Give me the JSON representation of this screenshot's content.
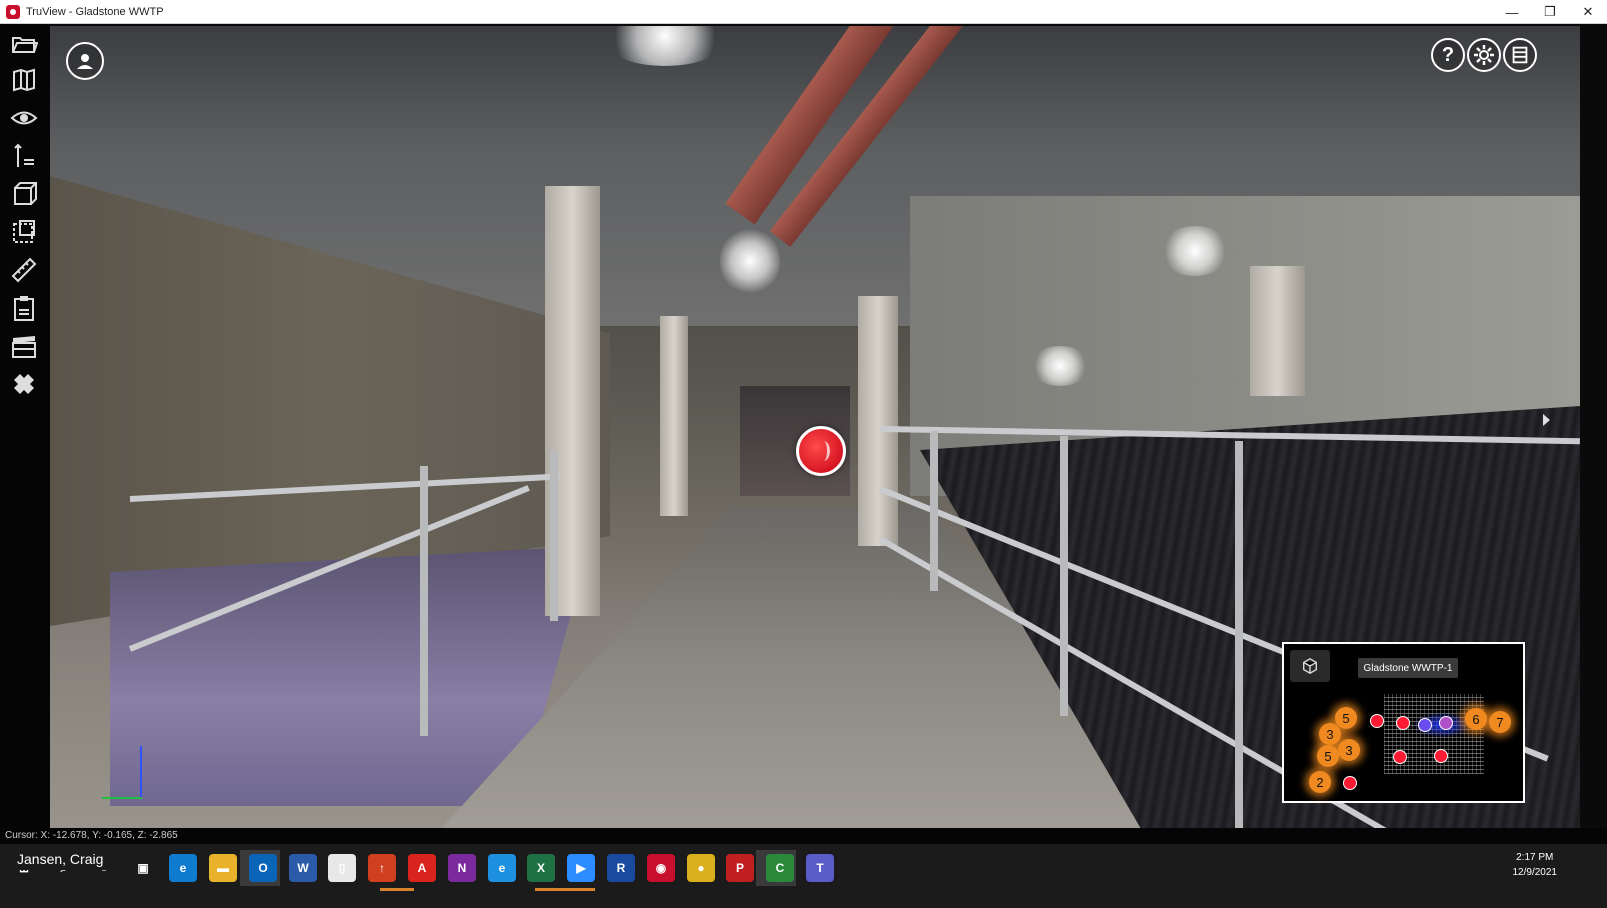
{
  "window": {
    "title": "TruView - Gladstone WWTP",
    "controls": {
      "minimize": "—",
      "maximize": "❐",
      "close": "✕"
    }
  },
  "sidebar": {
    "tools": [
      {
        "icon": "open-folder-icon"
      },
      {
        "icon": "map-icon"
      },
      {
        "icon": "eye-icon"
      },
      {
        "icon": "measure-height-icon"
      },
      {
        "icon": "3d-view-icon"
      },
      {
        "icon": "markup-icon"
      },
      {
        "icon": "ruler-icon"
      },
      {
        "icon": "clipboard-icon"
      },
      {
        "icon": "clapperboard-icon"
      },
      {
        "icon": "plugin-icon"
      }
    ]
  },
  "viewport": {
    "user_button_icon": "user-circle-icon",
    "help_label": "?",
    "settings_icon": "gear-icon",
    "layers_icon": "layers-icon"
  },
  "minimap": {
    "title": "Gladstone WWTP-1",
    "nodes": [
      "5",
      "3",
      "3",
      "5",
      "2",
      "6",
      "7"
    ]
  },
  "status": {
    "cursor": "Cursor: X: -12.678, Y: -0.165, Z: -2.865"
  },
  "taskbar": {
    "user_name": "Jansen, Craig",
    "time": "2:17 PM",
    "date": "12/9/2021",
    "apps": [
      {
        "name": "windows-start",
        "label": "⊞",
        "color": "#1b1b1b"
      },
      {
        "name": "search",
        "label": "⌕",
        "color": "#1b1b1b"
      },
      {
        "name": "task-view",
        "label": "○",
        "color": "#1b1b1b"
      },
      {
        "name": "taskbar-apps",
        "label": "▣",
        "color": "#1b1b1b"
      },
      {
        "name": "edge",
        "label": "e",
        "color": "#0f7ccf"
      },
      {
        "name": "file-explorer",
        "label": "▬",
        "color": "#e8b32b"
      },
      {
        "name": "outlook",
        "label": "O",
        "color": "#0a64b8"
      },
      {
        "name": "word",
        "label": "W",
        "color": "#2b5aa8"
      },
      {
        "name": "notepad",
        "label": "▯",
        "color": "#e8e8e8"
      },
      {
        "name": "pointer-app",
        "label": "↑",
        "color": "#d04020"
      },
      {
        "name": "acrobat",
        "label": "A",
        "color": "#d8241c"
      },
      {
        "name": "onenote",
        "label": "N",
        "color": "#7a2a9c"
      },
      {
        "name": "internet-explorer",
        "label": "e",
        "color": "#1e90e0"
      },
      {
        "name": "excel",
        "label": "X",
        "color": "#1e7145"
      },
      {
        "name": "zoom",
        "label": "▶",
        "color": "#2d8cff"
      },
      {
        "name": "revit",
        "label": "R",
        "color": "#1a4aa0"
      },
      {
        "name": "truview",
        "label": "◉",
        "color": "#c8102e"
      },
      {
        "name": "chrome",
        "label": "●",
        "color": "#dbb01e"
      },
      {
        "name": "pdf-app",
        "label": "P",
        "color": "#c02020"
      },
      {
        "name": "cyclone-app",
        "label": "C",
        "color": "#2a8a3a"
      },
      {
        "name": "teams",
        "label": "T",
        "color": "#5a5cc8"
      }
    ]
  }
}
